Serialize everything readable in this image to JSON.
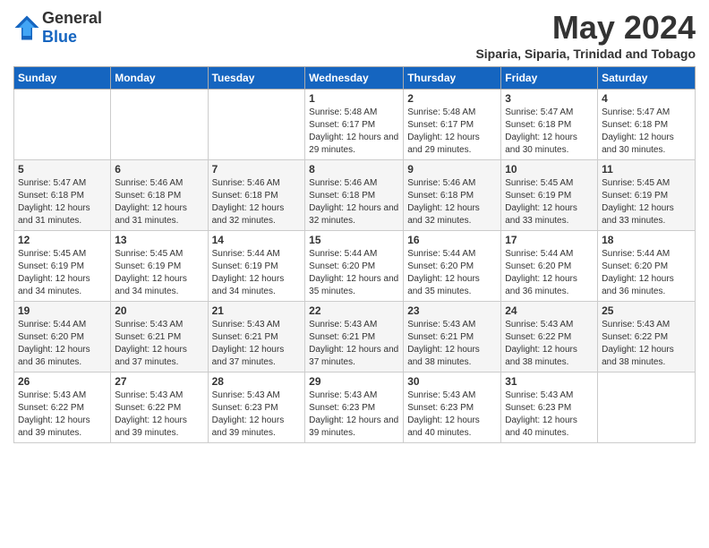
{
  "header": {
    "logo_general": "General",
    "logo_blue": "Blue",
    "month_title": "May 2024",
    "location": "Siparia, Siparia, Trinidad and Tobago"
  },
  "days_of_week": [
    "Sunday",
    "Monday",
    "Tuesday",
    "Wednesday",
    "Thursday",
    "Friday",
    "Saturday"
  ],
  "weeks": [
    [
      {
        "day": "",
        "sunrise": "",
        "sunset": "",
        "daylight": ""
      },
      {
        "day": "",
        "sunrise": "",
        "sunset": "",
        "daylight": ""
      },
      {
        "day": "",
        "sunrise": "",
        "sunset": "",
        "daylight": ""
      },
      {
        "day": "1",
        "sunrise": "Sunrise: 5:48 AM",
        "sunset": "Sunset: 6:17 PM",
        "daylight": "Daylight: 12 hours and 29 minutes."
      },
      {
        "day": "2",
        "sunrise": "Sunrise: 5:48 AM",
        "sunset": "Sunset: 6:17 PM",
        "daylight": "Daylight: 12 hours and 29 minutes."
      },
      {
        "day": "3",
        "sunrise": "Sunrise: 5:47 AM",
        "sunset": "Sunset: 6:18 PM",
        "daylight": "Daylight: 12 hours and 30 minutes."
      },
      {
        "day": "4",
        "sunrise": "Sunrise: 5:47 AM",
        "sunset": "Sunset: 6:18 PM",
        "daylight": "Daylight: 12 hours and 30 minutes."
      }
    ],
    [
      {
        "day": "5",
        "sunrise": "Sunrise: 5:47 AM",
        "sunset": "Sunset: 6:18 PM",
        "daylight": "Daylight: 12 hours and 31 minutes."
      },
      {
        "day": "6",
        "sunrise": "Sunrise: 5:46 AM",
        "sunset": "Sunset: 6:18 PM",
        "daylight": "Daylight: 12 hours and 31 minutes."
      },
      {
        "day": "7",
        "sunrise": "Sunrise: 5:46 AM",
        "sunset": "Sunset: 6:18 PM",
        "daylight": "Daylight: 12 hours and 32 minutes."
      },
      {
        "day": "8",
        "sunrise": "Sunrise: 5:46 AM",
        "sunset": "Sunset: 6:18 PM",
        "daylight": "Daylight: 12 hours and 32 minutes."
      },
      {
        "day": "9",
        "sunrise": "Sunrise: 5:46 AM",
        "sunset": "Sunset: 6:18 PM",
        "daylight": "Daylight: 12 hours and 32 minutes."
      },
      {
        "day": "10",
        "sunrise": "Sunrise: 5:45 AM",
        "sunset": "Sunset: 6:19 PM",
        "daylight": "Daylight: 12 hours and 33 minutes."
      },
      {
        "day": "11",
        "sunrise": "Sunrise: 5:45 AM",
        "sunset": "Sunset: 6:19 PM",
        "daylight": "Daylight: 12 hours and 33 minutes."
      }
    ],
    [
      {
        "day": "12",
        "sunrise": "Sunrise: 5:45 AM",
        "sunset": "Sunset: 6:19 PM",
        "daylight": "Daylight: 12 hours and 34 minutes."
      },
      {
        "day": "13",
        "sunrise": "Sunrise: 5:45 AM",
        "sunset": "Sunset: 6:19 PM",
        "daylight": "Daylight: 12 hours and 34 minutes."
      },
      {
        "day": "14",
        "sunrise": "Sunrise: 5:44 AM",
        "sunset": "Sunset: 6:19 PM",
        "daylight": "Daylight: 12 hours and 34 minutes."
      },
      {
        "day": "15",
        "sunrise": "Sunrise: 5:44 AM",
        "sunset": "Sunset: 6:20 PM",
        "daylight": "Daylight: 12 hours and 35 minutes."
      },
      {
        "day": "16",
        "sunrise": "Sunrise: 5:44 AM",
        "sunset": "Sunset: 6:20 PM",
        "daylight": "Daylight: 12 hours and 35 minutes."
      },
      {
        "day": "17",
        "sunrise": "Sunrise: 5:44 AM",
        "sunset": "Sunset: 6:20 PM",
        "daylight": "Daylight: 12 hours and 36 minutes."
      },
      {
        "day": "18",
        "sunrise": "Sunrise: 5:44 AM",
        "sunset": "Sunset: 6:20 PM",
        "daylight": "Daylight: 12 hours and 36 minutes."
      }
    ],
    [
      {
        "day": "19",
        "sunrise": "Sunrise: 5:44 AM",
        "sunset": "Sunset: 6:20 PM",
        "daylight": "Daylight: 12 hours and 36 minutes."
      },
      {
        "day": "20",
        "sunrise": "Sunrise: 5:43 AM",
        "sunset": "Sunset: 6:21 PM",
        "daylight": "Daylight: 12 hours and 37 minutes."
      },
      {
        "day": "21",
        "sunrise": "Sunrise: 5:43 AM",
        "sunset": "Sunset: 6:21 PM",
        "daylight": "Daylight: 12 hours and 37 minutes."
      },
      {
        "day": "22",
        "sunrise": "Sunrise: 5:43 AM",
        "sunset": "Sunset: 6:21 PM",
        "daylight": "Daylight: 12 hours and 37 minutes."
      },
      {
        "day": "23",
        "sunrise": "Sunrise: 5:43 AM",
        "sunset": "Sunset: 6:21 PM",
        "daylight": "Daylight: 12 hours and 38 minutes."
      },
      {
        "day": "24",
        "sunrise": "Sunrise: 5:43 AM",
        "sunset": "Sunset: 6:22 PM",
        "daylight": "Daylight: 12 hours and 38 minutes."
      },
      {
        "day": "25",
        "sunrise": "Sunrise: 5:43 AM",
        "sunset": "Sunset: 6:22 PM",
        "daylight": "Daylight: 12 hours and 38 minutes."
      }
    ],
    [
      {
        "day": "26",
        "sunrise": "Sunrise: 5:43 AM",
        "sunset": "Sunset: 6:22 PM",
        "daylight": "Daylight: 12 hours and 39 minutes."
      },
      {
        "day": "27",
        "sunrise": "Sunrise: 5:43 AM",
        "sunset": "Sunset: 6:22 PM",
        "daylight": "Daylight: 12 hours and 39 minutes."
      },
      {
        "day": "28",
        "sunrise": "Sunrise: 5:43 AM",
        "sunset": "Sunset: 6:23 PM",
        "daylight": "Daylight: 12 hours and 39 minutes."
      },
      {
        "day": "29",
        "sunrise": "Sunrise: 5:43 AM",
        "sunset": "Sunset: 6:23 PM",
        "daylight": "Daylight: 12 hours and 39 minutes."
      },
      {
        "day": "30",
        "sunrise": "Sunrise: 5:43 AM",
        "sunset": "Sunset: 6:23 PM",
        "daylight": "Daylight: 12 hours and 40 minutes."
      },
      {
        "day": "31",
        "sunrise": "Sunrise: 5:43 AM",
        "sunset": "Sunset: 6:23 PM",
        "daylight": "Daylight: 12 hours and 40 minutes."
      },
      {
        "day": "",
        "sunrise": "",
        "sunset": "",
        "daylight": ""
      }
    ]
  ]
}
